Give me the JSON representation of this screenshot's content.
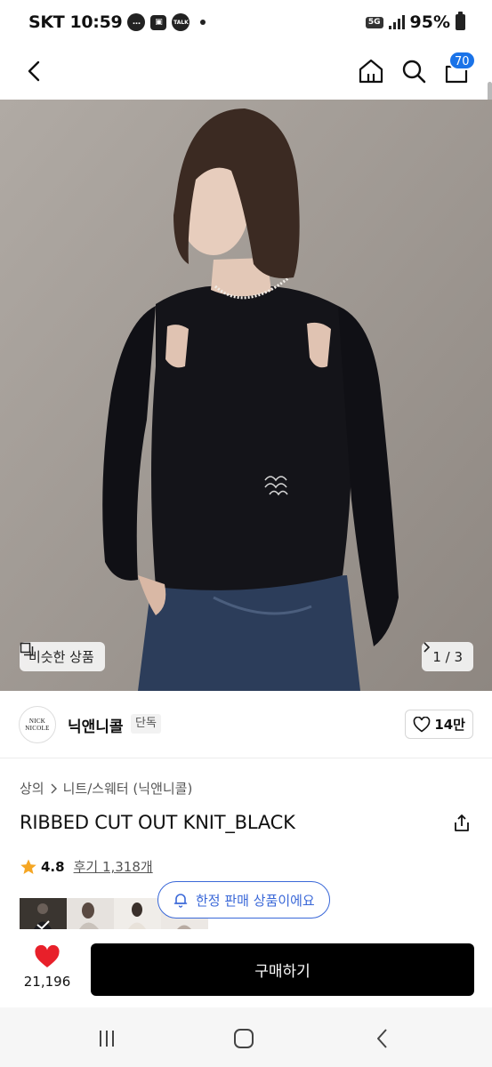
{
  "status_bar": {
    "carrier": "SKT",
    "time": "10:59",
    "notif_talk": "TALK",
    "network": "5G",
    "battery": "95%"
  },
  "header": {
    "cart_count": "70",
    "icons": [
      "back-arrow",
      "home",
      "search",
      "shopping-bag"
    ]
  },
  "hero": {
    "similar_label": "비슷한 상품",
    "page_indicator": "1 / 3"
  },
  "brand": {
    "logo_line1": "NICK",
    "logo_line2": "NICOLE",
    "name": "닉앤니콜",
    "tag": "단독",
    "likes": "14만"
  },
  "product": {
    "breadcrumb": [
      "상의",
      "니트/스웨터 (닉앤니콜)"
    ],
    "title": "RIBBED CUT OUT KNIT_BLACK",
    "rating": "4.8",
    "reviews": "후기 1,318개"
  },
  "promo": {
    "limited_label": "한정 판매 상품이에요"
  },
  "buy_bar": {
    "heart_count": "21,196",
    "buy_label": "구매하기"
  },
  "colors": {
    "accent_blue": "#1a73e8",
    "pill_blue": "#3a68d8",
    "heart_red": "#e8202a",
    "star_orange": "#f5a623"
  }
}
